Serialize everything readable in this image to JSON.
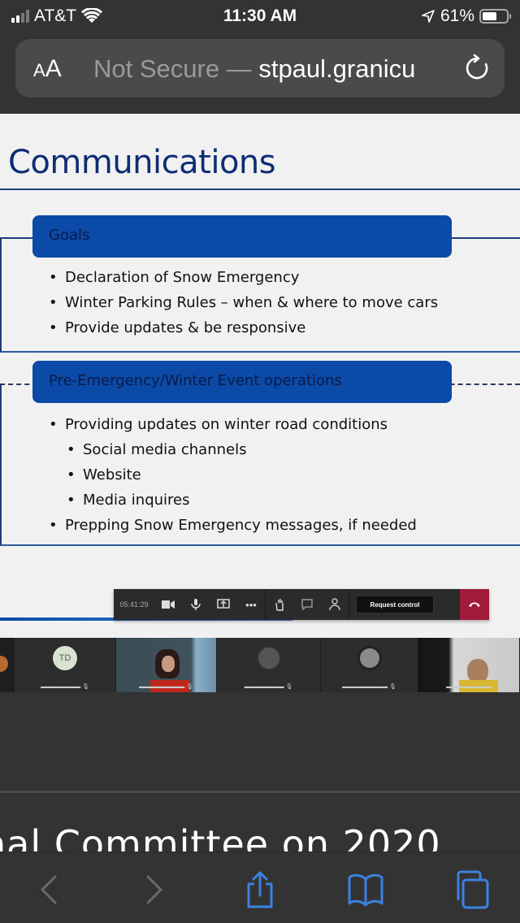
{
  "status_bar": {
    "carrier": "AT&T",
    "time": "11:30 AM",
    "battery": "61%",
    "battery_level": 0.61,
    "signal_bars_active": 2,
    "signal_bars_total": 4
  },
  "url_bar": {
    "reader_label": "AA",
    "security_text": "Not Secure —",
    "host": "stpaul.granicu"
  },
  "slide": {
    "title": "Communications",
    "sections": [
      {
        "header": "Goals",
        "bullets": [
          {
            "text": "Declaration of Snow Emergency",
            "level": 1
          },
          {
            "text": "Winter Parking Rules – when & where to move cars",
            "level": 1
          },
          {
            "text": "Provide updates & be responsive",
            "level": 1
          }
        ]
      },
      {
        "header": "Pre-Emergency/Winter Event operations",
        "bullets": [
          {
            "text": "Providing updates on winter road conditions",
            "level": 1
          },
          {
            "text": "Social media channels",
            "level": 2
          },
          {
            "text": "Website",
            "level": 2
          },
          {
            "text": "Media inquires",
            "level": 2
          },
          {
            "text": "Prepping Snow Emergency messages, if needed",
            "level": 1
          }
        ]
      }
    ]
  },
  "meeting_bar": {
    "timer": "05:41:29",
    "request_control_label": "Request control",
    "icons": [
      "camera-icon",
      "mic-icon",
      "share-screen-icon",
      "more-icon",
      "raise-hand-icon",
      "chat-icon",
      "participants-icon"
    ]
  },
  "participants": [
    {
      "name": "",
      "initials": ""
    },
    {
      "name": "",
      "initials": "TD"
    },
    {
      "name": "",
      "initials": ""
    },
    {
      "name": "",
      "initials": ""
    },
    {
      "name": "",
      "initials": ""
    },
    {
      "name": "",
      "initials": ""
    }
  ],
  "page": {
    "heading_fragment": "nal Committee on 2020"
  },
  "toolbar": {
    "buttons": [
      "back",
      "forward",
      "share",
      "bookmarks",
      "tabs"
    ]
  },
  "colors": {
    "accent_blue": "#3b82e0",
    "slide_header_blue": "#0b4aa6",
    "title_navy": "#0f2d74",
    "hangup_red": "#a01a3a"
  }
}
